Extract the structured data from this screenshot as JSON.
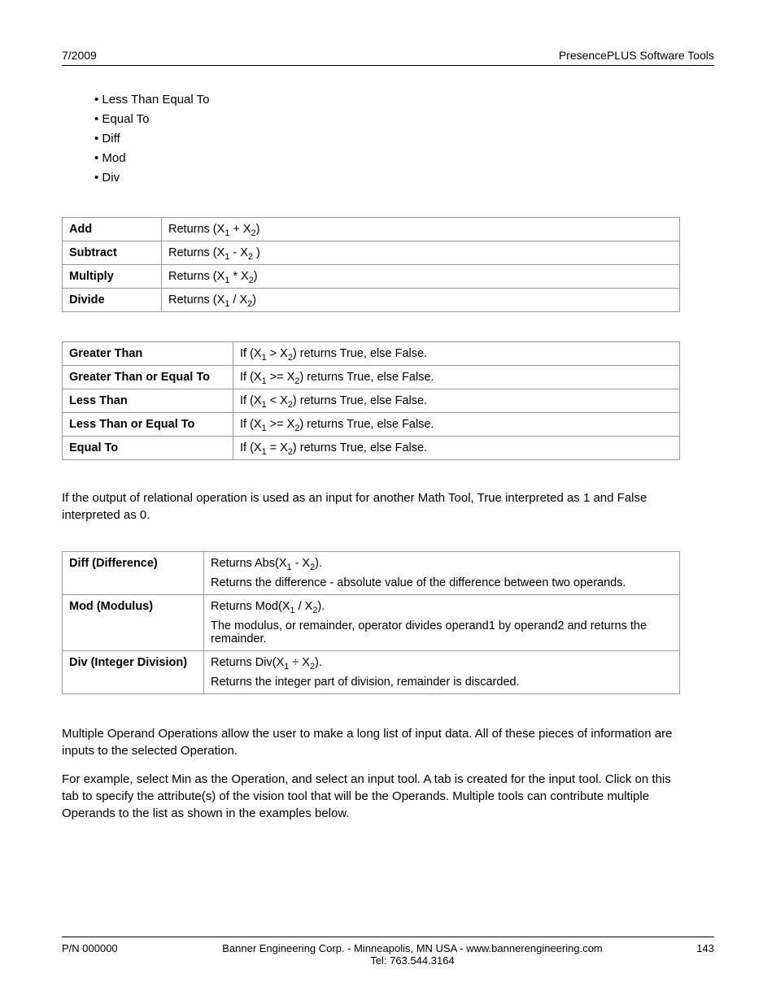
{
  "header": {
    "left": "7/2009",
    "right": "PresencePLUS Software Tools"
  },
  "bullets": [
    "Less Than Equal To",
    "Equal To",
    "Diff",
    "Mod",
    "Div"
  ],
  "t1": [
    {
      "label": "Add",
      "desc": "Returns (X₁ + X₂)"
    },
    {
      "label": "Subtract",
      "desc": "Returns (X₁ - X₂ )"
    },
    {
      "label": "Multiply",
      "desc": "Returns (X₁ * X₂)"
    },
    {
      "label": "Divide",
      "desc": "Returns (X₁ / X₂)"
    }
  ],
  "t2": [
    {
      "label": "Greater Than",
      "desc": "If (X₁ > X₂) returns True, else False."
    },
    {
      "label": "Greater Than or Equal To",
      "desc": "If (X₁ >= X₂) returns True, else False."
    },
    {
      "label": "Less Than",
      "desc": "If (X₁ < X₂) returns True, else False."
    },
    {
      "label": "Less Than or Equal To",
      "desc": "If (X₁ >= X₂) returns True, else False."
    },
    {
      "label": "Equal To",
      "desc": "If (X₁ = X₂) returns True, else False."
    }
  ],
  "p1": "If the output of relational operation is used as an input for another Math Tool, True interpreted as 1 and False interpreted as 0.",
  "t3": [
    {
      "label": "Diff (Difference)",
      "d1": "Returns Abs(X₁ - X₂).",
      "d2": "Returns the difference - absolute value of the difference between two operands."
    },
    {
      "label": "Mod (Modulus)",
      "d1": "Returns Mod(X₁ / X₂).",
      "d2": "The modulus, or remainder, operator divides operand1 by operand2 and returns the remainder."
    },
    {
      "label": "Div (Integer Division)",
      "d1": "Returns Div(X₁ ÷ X₂).",
      "d2": "Returns the integer part of division, remainder is discarded."
    }
  ],
  "p2": "Multiple Operand Operations allow the user to make a long list of input data. All of these pieces of information are inputs to the selected Operation.",
  "p3": "For example, select Min as the Operation, and select an input tool. A tab is created for the input tool. Click on this tab to specify the attribute(s) of the vision tool that will be the Operands. Multiple tools can contribute multiple Operands to the list as shown in the examples below.",
  "footer": {
    "pn": "P/N 000000",
    "line1": "Banner Engineering Corp. - Minneapolis, MN USA - www.bannerengineering.com",
    "line2": "Tel: 763.544.3164",
    "page": "143"
  }
}
